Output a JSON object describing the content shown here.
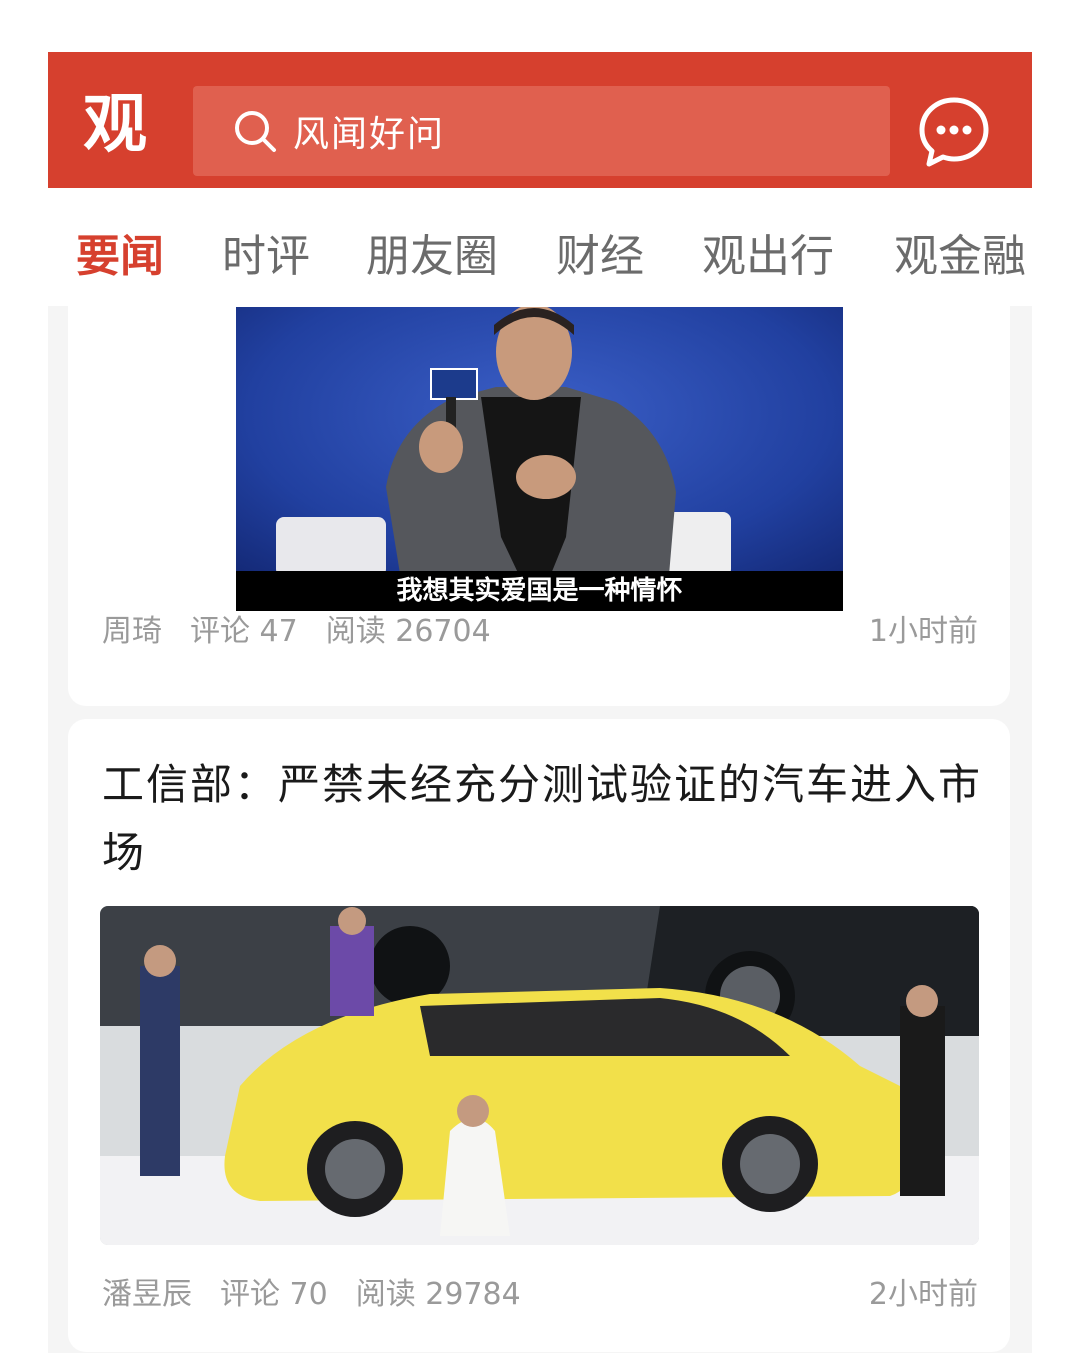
{
  "app": {
    "logo_char": "观",
    "search_placeholder": "风闻好问",
    "brand_color": "#d6402e"
  },
  "tabs": [
    {
      "label": "要闻",
      "active": true
    },
    {
      "label": "时评",
      "active": false
    },
    {
      "label": "朋友圈",
      "active": false
    },
    {
      "label": "财经",
      "active": false
    },
    {
      "label": "观出行",
      "active": false
    },
    {
      "label": "观金融",
      "active": false
    }
  ],
  "articles": [
    {
      "video_subtitle": "我想其实爱国是一种情怀",
      "author": "周琦",
      "comments": "评论 47",
      "reads": "阅读 26704",
      "time": "1小时前"
    },
    {
      "title": "工信部：严禁未经充分测试验证的汽车进入市场",
      "author": "潘昱辰",
      "comments": "评论 70",
      "reads": "阅读 29784",
      "time": "2小时前"
    }
  ]
}
